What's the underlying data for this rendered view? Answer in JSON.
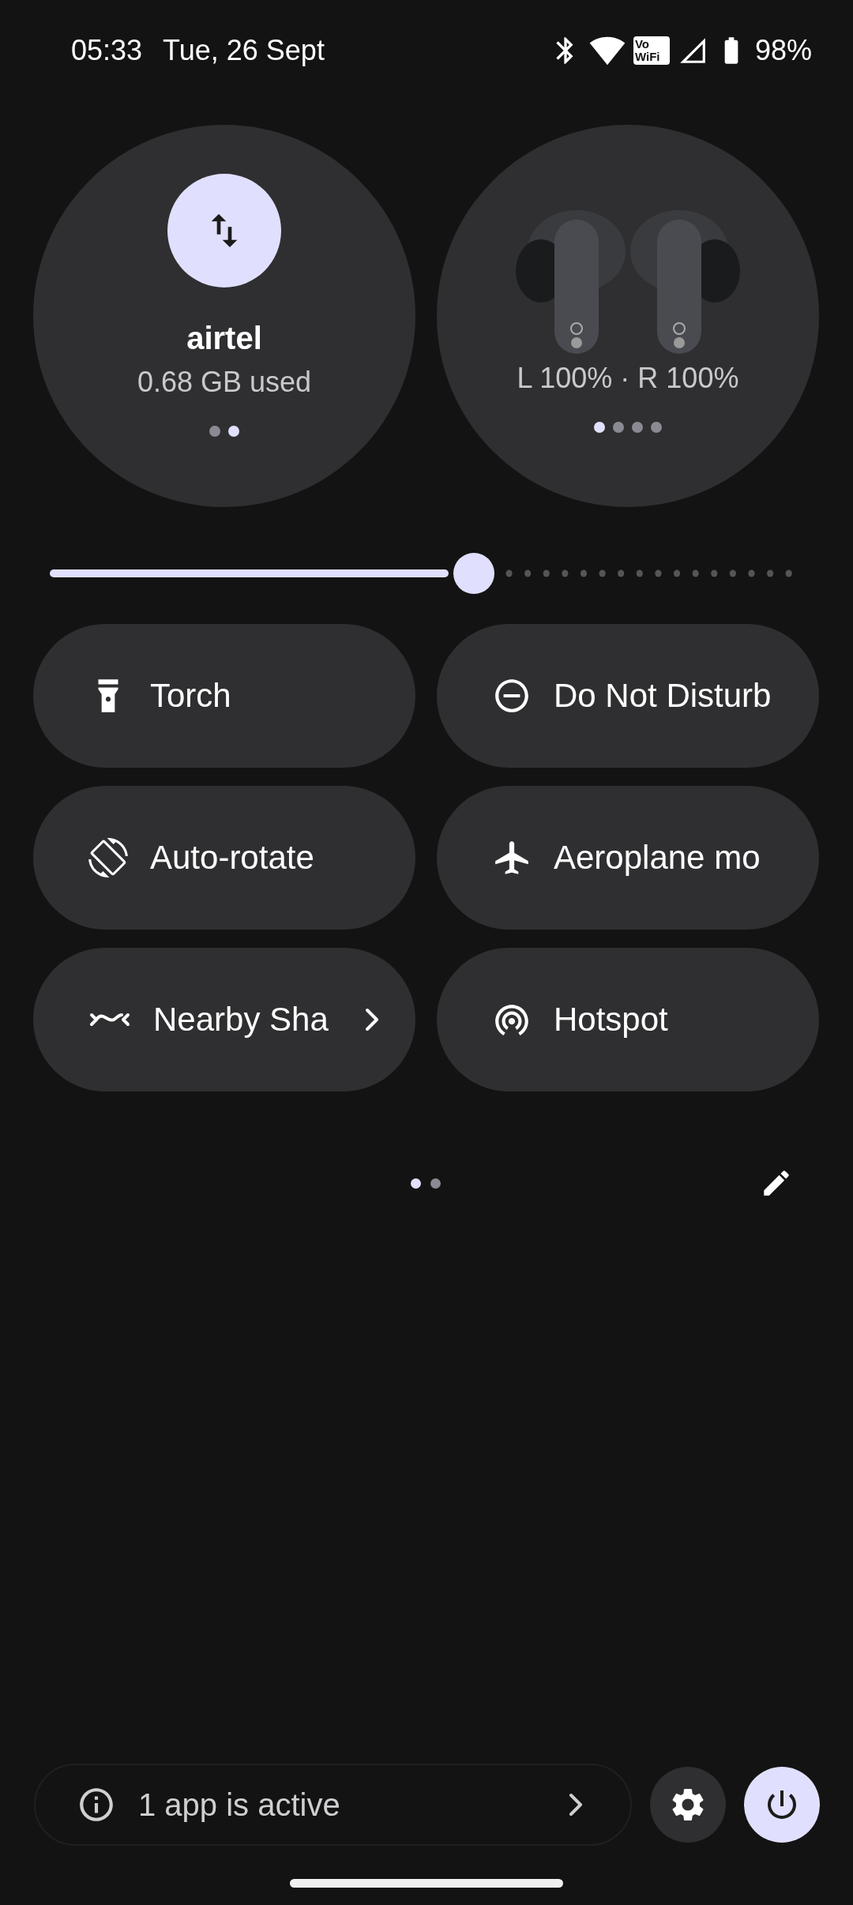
{
  "status_bar": {
    "time": "05:33",
    "date": "Tue, 26 Sept",
    "vowifi": "Vo WiFi",
    "battery": "98%"
  },
  "big_tiles": [
    {
      "kind": "data",
      "title": "airtel",
      "subtitle": "0.68 GB used",
      "pages": [
        {
          "selected": false
        },
        {
          "selected": true
        }
      ]
    },
    {
      "kind": "device",
      "subtitle": "L 100% · R 100%",
      "pages": [
        {
          "selected": true
        },
        {
          "selected": false
        },
        {
          "selected": false
        },
        {
          "selected": false
        }
      ]
    }
  ],
  "brightness": {
    "level": 0.537
  },
  "tiles": [
    {
      "kind": "torch",
      "label": "Torch",
      "on": false
    },
    {
      "kind": "dnd",
      "label": "Do Not Disturb",
      "on": false
    },
    {
      "kind": "rotate",
      "label": "Auto-rotate",
      "on": false
    },
    {
      "kind": "plane",
      "label": "Aeroplane mo",
      "on": false
    },
    {
      "kind": "nearby",
      "label": "Nearby Sha",
      "on": false,
      "chevron": true
    },
    {
      "kind": "hotspot",
      "label": "Hotspot",
      "on": false
    }
  ],
  "pager": [
    {
      "selected": true
    },
    {
      "selected": false
    }
  ],
  "footer": {
    "text": "1 app is active"
  }
}
